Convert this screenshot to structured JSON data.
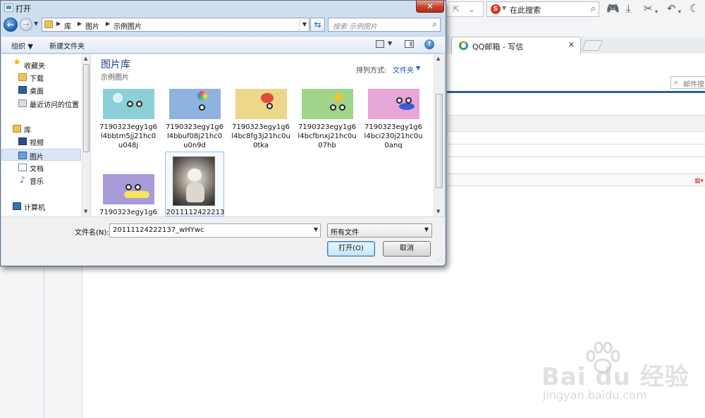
{
  "browser": {
    "search_placeholder": "在此搜索",
    "tab_title": "QQ邮箱 - 写信",
    "mail_search_placeholder": "邮件搜"
  },
  "dialog": {
    "title": "打开",
    "address_crumbs": [
      "库",
      "图片",
      "示例图片"
    ],
    "search_placeholder": "搜索 示例图片",
    "toolbar": {
      "organize_label": "组织",
      "new_folder_label": "新建文件夹"
    },
    "nav_items": [
      {
        "label": "收藏夹",
        "icon": "star-icon"
      },
      {
        "label": "下载",
        "icon": "folder-icon"
      },
      {
        "label": "桌面",
        "icon": "desktop-icon"
      },
      {
        "label": "最近访问的位置",
        "icon": "recent-places-icon"
      },
      {
        "label": "库",
        "icon": "library-icon"
      },
      {
        "label": "视频",
        "icon": "video-library-icon"
      },
      {
        "label": "图片",
        "icon": "pictures-library-icon"
      },
      {
        "label": "文档",
        "icon": "documents-library-icon"
      },
      {
        "label": "音乐",
        "icon": "music-note-icon"
      },
      {
        "label": "计算机",
        "icon": "computer-icon"
      }
    ],
    "library_title": "图片库",
    "library_subtitle": "示例图片",
    "arrange_label": "排列方式:",
    "arrange_value": "文件夹",
    "files": [
      {
        "name": "7190323egy1g6l4bbtm5jj21hc0u048j",
        "bg": "#8ccfd6"
      },
      {
        "name": "7190323egy1g6l4bbuf08j21hc0u0n9d",
        "bg": "#8fb3e0"
      },
      {
        "name": "7190323egy1g6l4bc8fg3j21hc0u0tka",
        "bg": "#ecd68a"
      },
      {
        "name": "7190323egy1g6l4bcfbnxj21hc0u07hb",
        "bg": "#9fd48a"
      },
      {
        "name": "7190323egy1g6l4bci230j21hc0u0anq",
        "bg": "#e6a6d6"
      },
      {
        "name": "7190323egy1g6",
        "bg": "#a99ad8"
      },
      {
        "name": "2011112422213",
        "bg": "#555555"
      }
    ],
    "filename_label": "文件名(N):",
    "filename_value": "20111124222137_wHYwc",
    "filetype_value": "所有文件",
    "open_button": "打开(O)",
    "cancel_button": "取消"
  },
  "watermark": {
    "main": "Bai du 经验",
    "sub": "jingyan.baidu.com"
  }
}
